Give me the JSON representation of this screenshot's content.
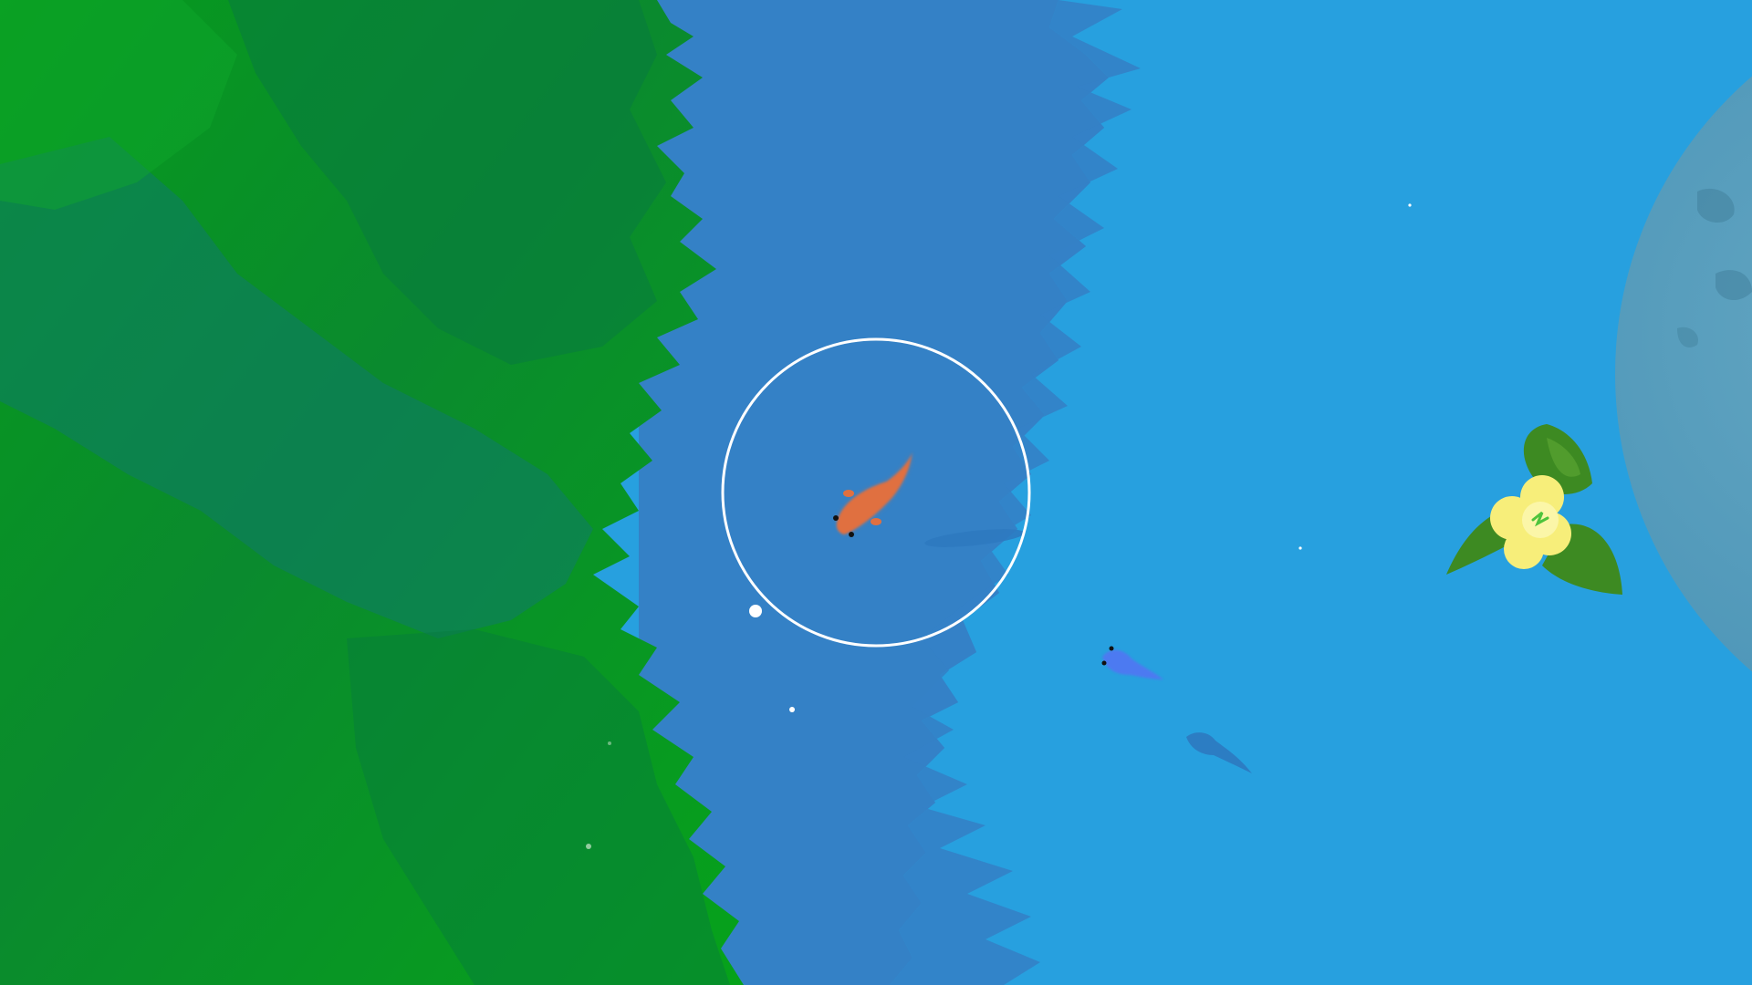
{
  "game": {
    "title": "",
    "colors": {
      "shallow_water": "#27a0df",
      "deep_water": "#3481c6",
      "grass_bright": "#0a9a1e",
      "grass_dark": "#077a3e",
      "grass_shadow": "#0f7a6a",
      "player_fish": "#e07040",
      "other_fish": "#4f78f2",
      "shadow_fish": "#2d79c0",
      "flower_petal": "#f7ee7a",
      "lily_leaf": "#3d8a22",
      "ring": "#ffffff",
      "planet": "#5a9ab5"
    },
    "entities": {
      "player": {
        "kind": "player-fish",
        "icon": "koi-fish-icon"
      },
      "other_fish": {
        "kind": "npc-fish",
        "icon": "blue-fish-icon"
      },
      "shadow_fish": {
        "kind": "shadow-fish",
        "icon": "fish-silhouette-icon"
      },
      "flower": {
        "kind": "lily-pad-flower",
        "icon": "flower-icon"
      },
      "ring": {
        "kind": "target-ring",
        "icon": "circle-ring-icon"
      },
      "planet": {
        "kind": "edge-planet",
        "icon": "planet-icon"
      }
    }
  }
}
